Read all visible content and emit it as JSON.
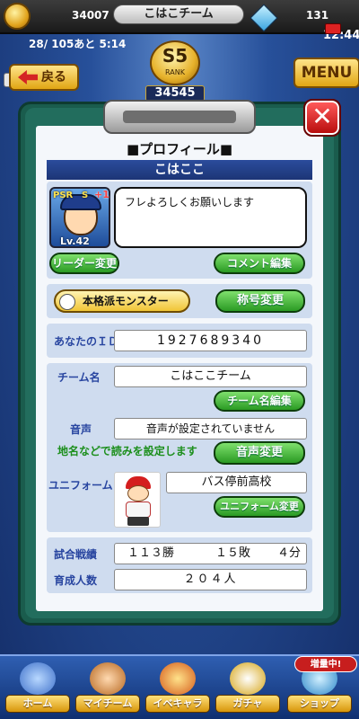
{
  "header": {
    "coins": "34007",
    "team_title": "こはこチーム",
    "gems": "131",
    "stamina": "28/ 105あと 5:14",
    "time": "12:44",
    "back_label": "戻る",
    "menu_label": "MENU",
    "rank": {
      "grade": "S5",
      "label": "RANK",
      "value": "34545"
    }
  },
  "profile": {
    "heading": "■プロフィール■",
    "name": "こはここ",
    "avatar": {
      "level": "Lv.42",
      "badge": "PSR",
      "grade": "S",
      "plus": "+1"
    },
    "comment": "フレよろしくお願いします",
    "leader_change_button": "リーダー変更",
    "comment_edit_button": "コメント編集",
    "title_badge": "本格派モンスター",
    "title_change_button": "称号変更",
    "id_label": "あなたのＩＤ",
    "id_value": "1927689340",
    "team_label": "チーム名",
    "team_value": "こはここチーム",
    "team_edit_button": "チーム名編集",
    "voice_label": "音声",
    "voice_value": "音声が設定されていません",
    "voice_hint": "地名などで読みを設定します",
    "voice_change_button": "音声変更",
    "uniform_label": "ユニフォーム",
    "uniform_value": "バス停前高校",
    "uniform_change_button": "ユニフォーム変更",
    "record_label": "試合戦績",
    "record_wins": "１１３勝",
    "record_losses": "１５敗",
    "record_draws": "４分",
    "trained_label": "育成人数",
    "trained_value": "２０４人"
  },
  "nav": {
    "items": [
      {
        "label": "ホーム"
      },
      {
        "label": "マイチーム"
      },
      {
        "label": "イベキャラ"
      },
      {
        "label": "ガチャ"
      },
      {
        "label": "ショップ"
      }
    ],
    "boost_badge": "増量中!"
  },
  "colors": {
    "accent_green": "#2a9a23",
    "header_blue": "#1c3576",
    "close_red": "#b80d0d"
  }
}
